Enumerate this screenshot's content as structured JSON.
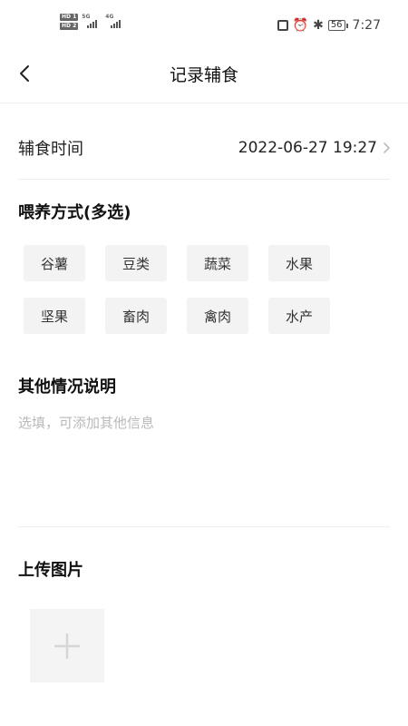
{
  "status_bar": {
    "time": "7:27",
    "battery": "56",
    "network_1": "5G",
    "network_2": "4G",
    "hd_badge": "HD",
    "sim_1": "1",
    "sim_2": "2",
    "icons": [
      "nfc-icon",
      "alarm-icon",
      "bluetooth-icon",
      "battery-icon",
      "signal-icon"
    ]
  },
  "header": {
    "title": "记录辅食",
    "back_icon": "back-chevron-icon"
  },
  "feeding_time": {
    "label": "辅食时间",
    "value": "2022-06-27 19:27"
  },
  "feeding_method": {
    "title": "喂养方式(多选)",
    "options": [
      "谷薯",
      "豆类",
      "蔬菜",
      "水果",
      "坚果",
      "畜肉",
      "禽肉",
      "水产"
    ]
  },
  "notes": {
    "title": "其他情况说明",
    "placeholder": "选填，可添加其他信息",
    "value": ""
  },
  "upload": {
    "title": "上传图片",
    "add_icon": "plus-icon"
  }
}
